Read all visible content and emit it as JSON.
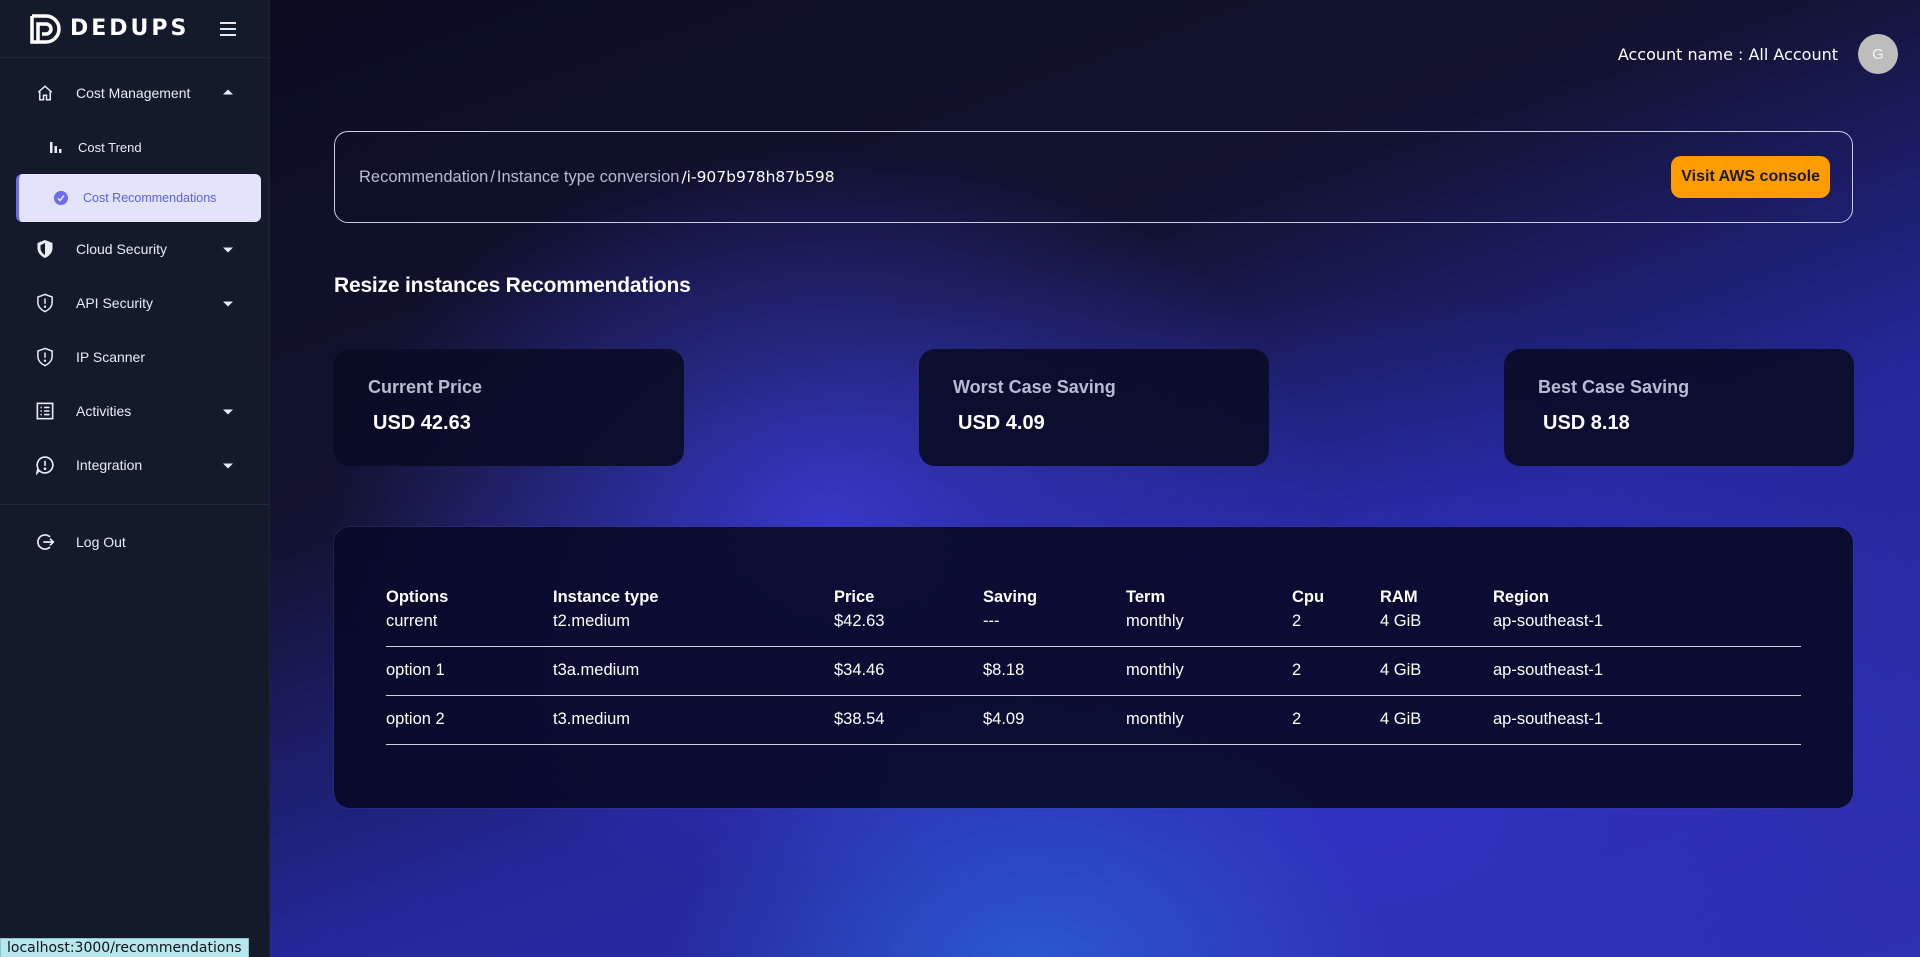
{
  "brand": {
    "name": "DEDUPS"
  },
  "sidebar": {
    "items": [
      {
        "label": "Cost Management",
        "icon": "home-icon",
        "expanded": true
      },
      {
        "label": "Cost Trend",
        "icon": "bar-chart-icon",
        "sub": true
      },
      {
        "label": "Cost Recommendations",
        "icon": "recommendation-icon",
        "sub": true,
        "active": true
      },
      {
        "label": "Cloud Security",
        "icon": "shield-filled-icon",
        "expandable": true
      },
      {
        "label": "API Security",
        "icon": "shield-alert-icon",
        "expandable": true
      },
      {
        "label": "IP Scanner",
        "icon": "shield-alert-icon"
      },
      {
        "label": "Activities",
        "icon": "list-icon",
        "expandable": true
      },
      {
        "label": "Integration",
        "icon": "chat-alert-icon",
        "expandable": true
      },
      {
        "label": "Log Out",
        "icon": "logout-icon"
      }
    ]
  },
  "status_url": "localhost:3000/recommendations",
  "header": {
    "account_label": "Account name : All Account",
    "avatar_initial": "G"
  },
  "breadcrumb": {
    "items": [
      "Recommendation",
      "Instance type conversion"
    ],
    "separator": "/",
    "current": "/i-907b978h87b598"
  },
  "actions": {
    "visit_console": "Visit AWS console"
  },
  "section_title": "Resize instances Recommendations",
  "cards": [
    {
      "label": "Current Price",
      "value": "USD 42.63"
    },
    {
      "label": "Worst Case Saving",
      "value": "USD 4.09"
    },
    {
      "label": "Best Case Saving",
      "value": "USD 8.18"
    }
  ],
  "table": {
    "columns": [
      "Options",
      "Instance type",
      "Price",
      "Saving",
      "Term",
      "Cpu",
      "RAM",
      "Region"
    ],
    "rows": [
      [
        "current",
        "t2.medium",
        "$42.63",
        "---",
        "monthly",
        "2",
        "4 GiB",
        "ap-southeast-1"
      ],
      [
        "option 1",
        "t3a.medium",
        "$34.46",
        "$8.18",
        "monthly",
        "2",
        "4 GiB",
        "ap-southeast-1"
      ],
      [
        "option 2",
        "t3.medium",
        "$38.54",
        "$4.09",
        "monthly",
        "2",
        "4 GiB",
        "ap-southeast-1"
      ]
    ]
  },
  "colors": {
    "sidebar_bg": "#131a2a",
    "active_bg": "#e3e4fb",
    "active_text": "#5b5fe0",
    "button_bg": "#ff9d00"
  }
}
